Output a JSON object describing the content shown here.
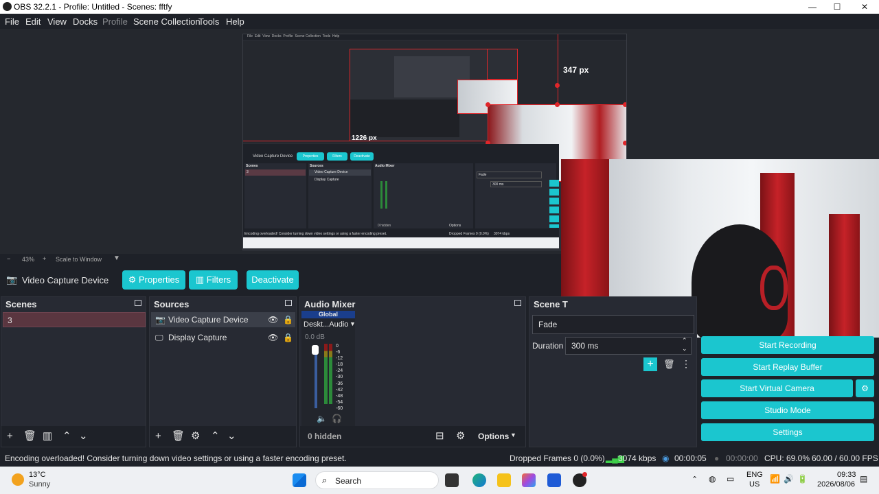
{
  "window": {
    "title": "OBS 32.2.1 - Profile: Untitled - Scenes: fftfy",
    "minimize": "—",
    "maximize": "☐",
    "close": "✕"
  },
  "menu": {
    "items": [
      "File",
      "Edit",
      "View",
      "Docks",
      "Profile",
      "Scene Collection",
      "Tools",
      "Help"
    ]
  },
  "preview": {
    "measure_height": "347 px",
    "measure_width": "1226 px",
    "inner_menu": [
      "File",
      "Edit",
      "View",
      "Docks",
      "Profile",
      "Scene Collection",
      "Tools",
      "Help"
    ],
    "inner_source": "Video Capture Device",
    "inner_properties": "Properties",
    "inner_filters": "Filters",
    "inner_deactivate": "Deactivate",
    "inner_scenes": "Scenes",
    "inner_sources": "Sources",
    "inner_audio": "Audio Mixer",
    "inner_scene_item": "3",
    "inner_source1": "Video Capture Device",
    "inner_source2": "Display Capture",
    "inner_fade": "Fade",
    "inner_duration": "300 ms",
    "inner_hidden": "0 hidden",
    "inner_options": "Options",
    "inner_status": "Encoding overloaded! Consider turning down video settings or using a faster encoding preset.",
    "inner_dropped": "Dropped Frames 0 (0.0%)",
    "inner_kbps": "3074 kbps"
  },
  "zoom": {
    "minus": "−",
    "level": "43%",
    "plus": "+",
    "scale": "Scale to Window"
  },
  "sourcebar": {
    "name": "Video Capture Device",
    "properties": "Properties",
    "filters": "Filters",
    "deactivate": "Deactivate"
  },
  "scenes": {
    "title": "Scenes",
    "items": [
      "3"
    ]
  },
  "sources": {
    "title": "Sources",
    "items": [
      "Video Capture Device",
      "Display Capture"
    ]
  },
  "audio": {
    "title": "Audio Mixer",
    "global": "Global",
    "channel": "Deskt...Audio",
    "db": "0.0 dB",
    "scale": [
      "0",
      "-6",
      "-12",
      "-18",
      "-24",
      "-30",
      "-36",
      "-42",
      "-48",
      "-54",
      "-60"
    ],
    "hidden": "0 hidden",
    "options": "Options"
  },
  "transitions": {
    "title": "Scene T",
    "type": "Fade",
    "duration_label": "Duration",
    "duration_value": "300 ms"
  },
  "controls": {
    "start_recording": "Start Recording",
    "start_replay": "Start Replay Buffer",
    "start_virtual": "Start Virtual Camera",
    "studio_mode": "Studio Mode",
    "settings": "Settings"
  },
  "status": {
    "message": "Encoding overloaded! Consider turning down video settings or using a faster encoding preset.",
    "dropped": "Dropped Frames 0 (0.0%)",
    "kbps": "3074 kbps",
    "live_time": "00:00:05",
    "rec_time": "00:00:00",
    "cpu": "CPU: 69.0%",
    "fps": "60.00 / 60.00 FPS"
  },
  "taskbar": {
    "temp": "13°C",
    "weather": "Sunny",
    "search": "Search",
    "lang1": "ENG",
    "lang2": "US",
    "time": "09:33",
    "date": "2026/08/06"
  },
  "colors": {
    "accent": "#1bc6cf",
    "recording_red": "#e0262a",
    "panel": "#272a33",
    "background": "#1e2128"
  }
}
